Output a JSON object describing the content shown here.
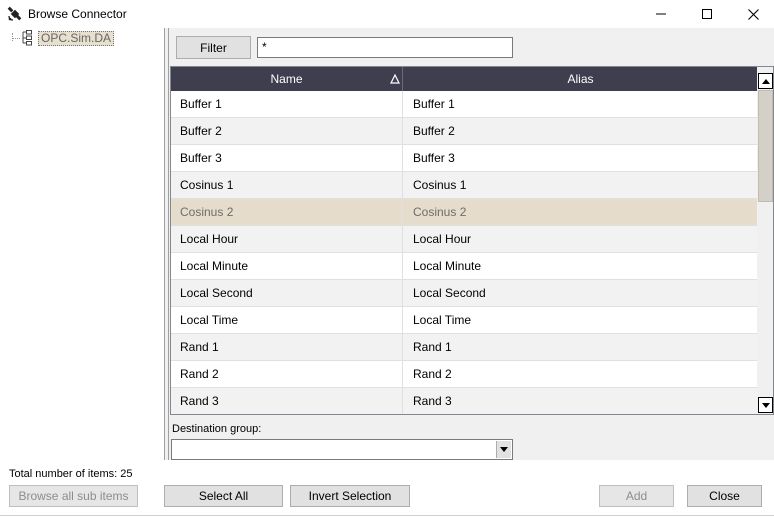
{
  "window": {
    "title": "Browse Connector",
    "icon": "satellite-icon",
    "controls": [
      "minimize-icon",
      "maximize-icon",
      "close-icon"
    ]
  },
  "tree": {
    "nodes": [
      {
        "label": "OPC.Sim.DA",
        "icon": "server-tree-icon",
        "selected": true
      }
    ]
  },
  "filter": {
    "button_label": "Filter",
    "value": "*"
  },
  "grid": {
    "columns": [
      {
        "label": "Name",
        "sort": "ascending"
      },
      {
        "label": "Alias"
      }
    ],
    "rows": [
      {
        "name": "Buffer 1",
        "alias": "Buffer 1"
      },
      {
        "name": "Buffer 2",
        "alias": "Buffer 2"
      },
      {
        "name": "Buffer 3",
        "alias": "Buffer 3"
      },
      {
        "name": "Cosinus 1",
        "alias": "Cosinus 1"
      },
      {
        "name": "Cosinus 2",
        "alias": "Cosinus 2",
        "selected": true
      },
      {
        "name": "Local Hour",
        "alias": "Local Hour"
      },
      {
        "name": "Local Minute",
        "alias": "Local Minute"
      },
      {
        "name": "Local Second",
        "alias": "Local Second"
      },
      {
        "name": "Local Time",
        "alias": "Local Time"
      },
      {
        "name": "Rand 1",
        "alias": "Rand 1"
      },
      {
        "name": "Rand 2",
        "alias": "Rand 2"
      },
      {
        "name": "Rand 3",
        "alias": "Rand 3"
      }
    ],
    "header_color": "#3e3e4e",
    "selected_row_color": "#e5dccb"
  },
  "destination": {
    "label": "Destination group:",
    "value": ""
  },
  "footer": {
    "total_label": "Total number of items: 25",
    "browse_all_label": "Browse all sub items",
    "select_all_label": "Select All",
    "invert_selection_label": "Invert Selection",
    "add_label": "Add",
    "close_label": "Close"
  }
}
